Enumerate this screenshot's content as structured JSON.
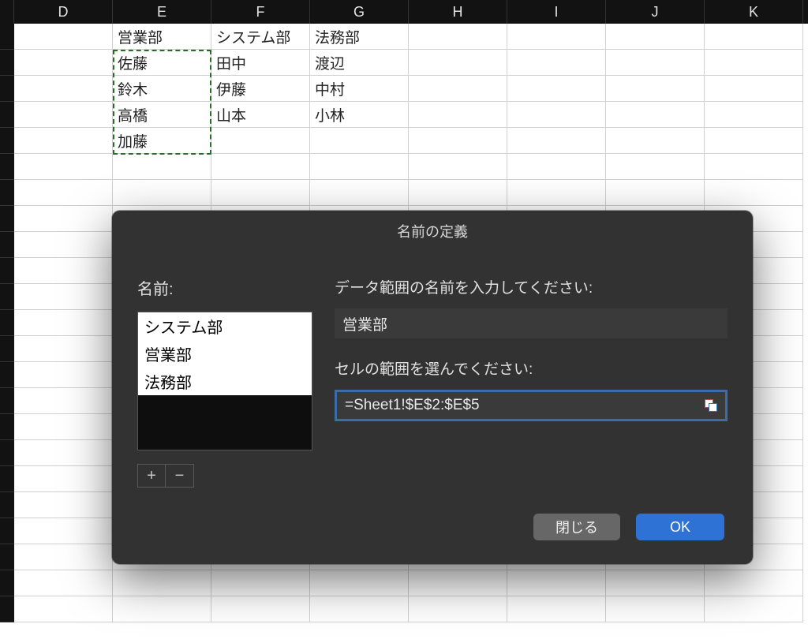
{
  "columns": [
    "D",
    "E",
    "F",
    "G",
    "H",
    "I",
    "J",
    "K"
  ],
  "cells": {
    "r0": {
      "E": "営業部",
      "F": "システム部",
      "G": "法務部"
    },
    "r1": {
      "E": "佐藤",
      "F": "田中",
      "G": "渡辺"
    },
    "r2": {
      "E": "鈴木",
      "F": "伊藤",
      "G": "中村"
    },
    "r3": {
      "E": "高橋",
      "F": "山本",
      "G": "小林"
    },
    "r4": {
      "E": "加藤"
    }
  },
  "dialog": {
    "title": "名前の定義",
    "name_label": "名前:",
    "names_list": [
      "システム部",
      "営業部",
      "法務部"
    ],
    "add_label": "+",
    "remove_label": "−",
    "data_range_label": "データ範囲の名前を入力してください:",
    "name_value": "営業部",
    "cell_range_label": "セルの範囲を選んでください:",
    "range_value": "=Sheet1!$E$2:$E$5",
    "close_label": "閉じる",
    "ok_label": "OK"
  }
}
